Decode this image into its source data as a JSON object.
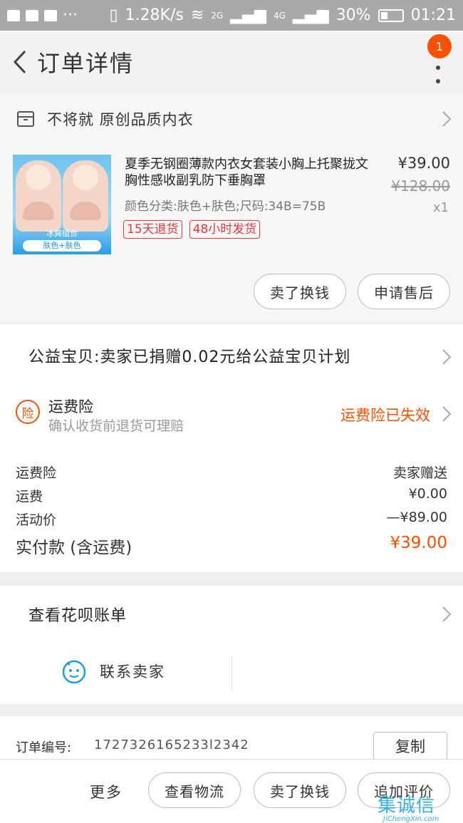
{
  "status_bar": {
    "net_speed": "1.28K/s",
    "sim1": "2G",
    "sim2": "4G",
    "battery": "30%",
    "time": "01:21"
  },
  "header": {
    "title": "订单详情",
    "badge_count": "1"
  },
  "shop": {
    "name": "不将就 原创品质内衣"
  },
  "product": {
    "title": "夏季无钢圈薄款内衣女套装小胸上托聚拢文胸性感收副乳防下垂胸罩",
    "sku": "颜色分类:肤色+肤色;尺码:34B=75B",
    "tags": [
      "15天退货",
      "48小时发货"
    ],
    "price": "¥39.00",
    "original_price": "¥128.00",
    "quantity": "x1",
    "image_caption_1": "冰爽组合",
    "image_caption_2": "肤色+肤色"
  },
  "product_actions": {
    "sell_label": "卖了换钱",
    "aftersale_label": "申请售后"
  },
  "charity": {
    "text": "公益宝贝:卖家已捐赠0.02元给公益宝贝计划"
  },
  "insurance": {
    "icon_char": "险",
    "title": "运费险",
    "subtitle": "确认收货前退货可理赔",
    "status": "运费险已失效"
  },
  "fees": [
    {
      "label": "运费险",
      "value": "卖家赠送"
    },
    {
      "label": "运费",
      "value": "¥0.00"
    },
    {
      "label": "活动价",
      "value": "—¥89.00"
    },
    {
      "label": "实付款 (含运费)",
      "value": "¥39.00"
    }
  ],
  "huabei": {
    "label": "查看花呗账单"
  },
  "contact": {
    "label": "联系卖家"
  },
  "order": {
    "number_label": "订单编号:",
    "number": "1727326165233l2342",
    "copy_label": "复制"
  },
  "bottom_bar": {
    "more": "更多",
    "logistics": "查看物流",
    "sell": "卖了换钱",
    "review": "追加评价"
  },
  "watermark": {
    "logo": "集诚信",
    "domain": "JiChengXin.com"
  },
  "colors": {
    "accent": "#ff5000",
    "tag_red": "#e4393c",
    "link_blue": "#1e9be8"
  }
}
